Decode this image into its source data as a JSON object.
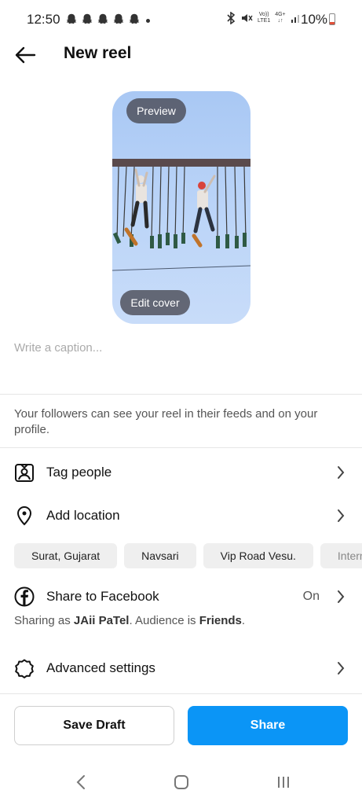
{
  "status_bar": {
    "time": "12:50",
    "network_label_top": "Vo))",
    "network_label_bottom": "LTE1",
    "data_label_top": "4G+",
    "data_label_bottom": "↓↑",
    "battery": "10%",
    "icons": [
      "snapchat-icon",
      "bluetooth-icon",
      "mute-icon",
      "signal-icon",
      "battery-icon"
    ]
  },
  "header": {
    "title": "New reel"
  },
  "preview": {
    "preview_label": "Preview",
    "edit_cover_label": "Edit cover"
  },
  "caption": {
    "placeholder": "Write a caption...",
    "value": ""
  },
  "info": {
    "text": "Your followers can see your reel in their feeds and on your profile."
  },
  "options": {
    "tag_people": "Tag people",
    "add_location": "Add location",
    "share_to_facebook": "Share to Facebook",
    "facebook_status": "On",
    "facebook_sub_prefix": "Sharing as ",
    "facebook_account": "JAii PaTel",
    "facebook_sub_middle": ". Audience is ",
    "facebook_audience": "Friends",
    "facebook_sub_suffix": ".",
    "advanced_settings": "Advanced settings"
  },
  "location_suggestions": [
    "Surat, Gujarat",
    "Navsari",
    "Vip Road Vesu.",
    "Internatio"
  ],
  "actions": {
    "save_draft": "Save Draft",
    "share": "Share"
  },
  "colors": {
    "accent": "#0b95f6",
    "battery_low": "#e0503a"
  }
}
